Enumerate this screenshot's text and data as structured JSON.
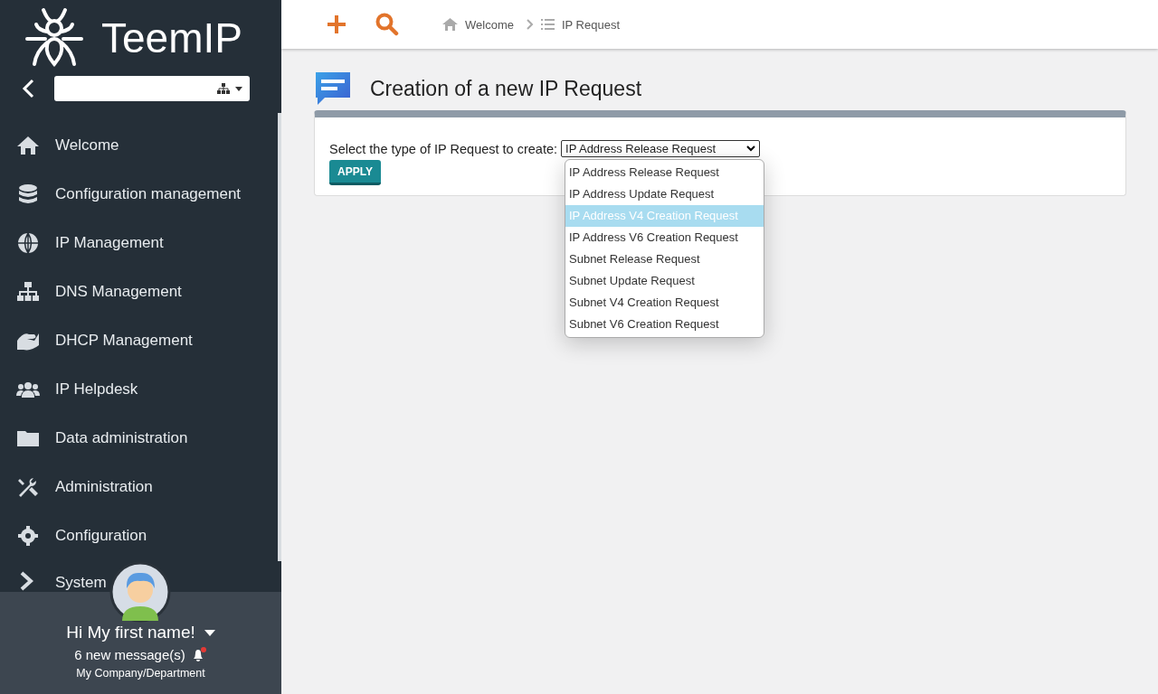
{
  "brand": {
    "name": "TeemIP"
  },
  "menu": [
    {
      "label": "Welcome"
    },
    {
      "label": "Configuration management"
    },
    {
      "label": "IP Management"
    },
    {
      "label": "DNS Management"
    },
    {
      "label": "DHCP Management"
    },
    {
      "label": "IP Helpdesk"
    },
    {
      "label": "Data administration"
    },
    {
      "label": "Administration"
    },
    {
      "label": "Configuration"
    },
    {
      "label": "System"
    }
  ],
  "user": {
    "greeting": "Hi My first name!",
    "messages": "6 new message(s)",
    "has_unread": true,
    "organization": "My Company/Department"
  },
  "breadcrumb": [
    {
      "label": "Welcome"
    },
    {
      "label": "IP Request"
    }
  ],
  "page": {
    "title": "Creation of a new IP Request",
    "prompt": "Select the type of IP Request to create:",
    "selected_value": "IP Address Release Request",
    "apply": "APPLY"
  },
  "dropdown_options": [
    {
      "label": "IP Address Release Request",
      "selected": false
    },
    {
      "label": "IP Address Update Request",
      "selected": false
    },
    {
      "label": "IP Address V4 Creation Request",
      "selected": true
    },
    {
      "label": "IP Address V6 Creation Request",
      "selected": false
    },
    {
      "label": "Subnet Release Request",
      "selected": false
    },
    {
      "label": "Subnet Update Request",
      "selected": false
    },
    {
      "label": "Subnet V4 Creation Request",
      "selected": false
    },
    {
      "label": "Subnet V6 Creation Request",
      "selected": false
    }
  ]
}
